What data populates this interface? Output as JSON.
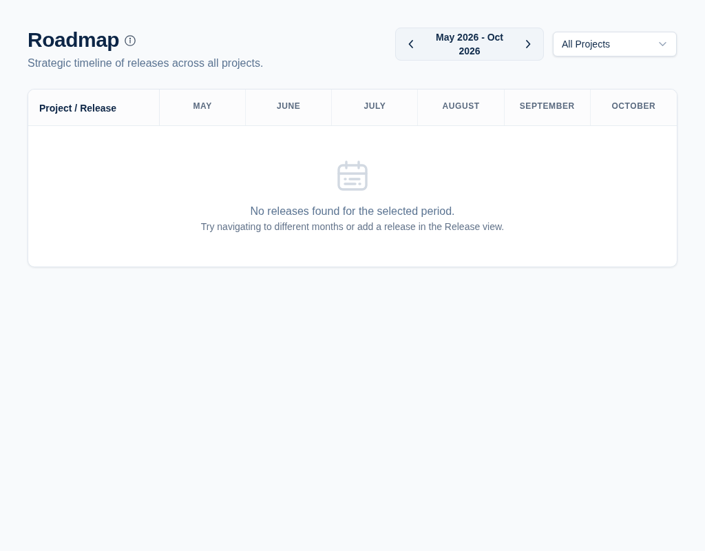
{
  "header": {
    "title": "Roadmap",
    "subtitle": "Strategic timeline of releases across all projects."
  },
  "date_range": {
    "label": "May 2026 - Oct 2026"
  },
  "project_filter": {
    "value": "All Projects"
  },
  "table": {
    "columns": [
      "Project / Release",
      "MAY",
      "JUNE",
      "JULY",
      "AUGUST",
      "SEPTEMBER",
      "OCTOBER"
    ],
    "empty_state": {
      "message": "No releases found for the selected period.",
      "hint": "Try navigating to different months or add a release in the Release view."
    }
  }
}
